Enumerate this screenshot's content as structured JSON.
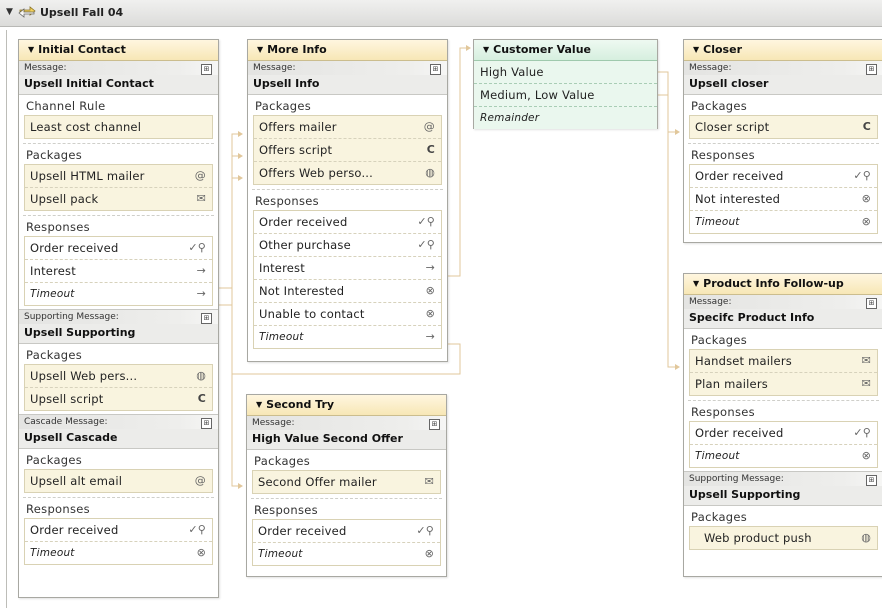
{
  "header": {
    "title": "Upsell Fall 04"
  },
  "icons": {
    "email": "@",
    "script": "C",
    "web": "globe",
    "mail": "envelope",
    "order": "check-search",
    "arrow": "arrow-right",
    "cancel": "circle-x"
  },
  "initial_contact": {
    "title": "Initial Contact",
    "message_label": "Message:",
    "message_name": "Upsell Initial Contact",
    "channel_rule_label": "Channel Rule",
    "channel_rule_value": "Least cost channel",
    "packages_label": "Packages",
    "packages": [
      "Upsell HTML mailer",
      "Upsell pack"
    ],
    "responses_label": "Responses",
    "responses": [
      "Order received",
      "Interest",
      "Timeout"
    ],
    "supporting_label": "Supporting Message:",
    "supporting_name": "Upsell Supporting",
    "supporting_packages_label": "Packages",
    "supporting_packages": [
      "Upsell Web pers...",
      "Upsell script"
    ],
    "cascade_label": "Cascade Message:",
    "cascade_name": "Upsell Cascade",
    "cascade_packages_label": "Packages",
    "cascade_packages": [
      "Upsell alt email"
    ],
    "cascade_responses_label": "Responses",
    "cascade_responses": [
      "Order received",
      "Timeout"
    ]
  },
  "more_info": {
    "title": "More Info",
    "message_label": "Message:",
    "message_name": "Upsell Info",
    "packages_label": "Packages",
    "packages": [
      "Offers mailer",
      "Offers script",
      "Offers Web perso..."
    ],
    "responses_label": "Responses",
    "responses": [
      "Order received",
      "Other purchase",
      "Interest",
      "Not Interested",
      "Unable to contact",
      "Timeout"
    ]
  },
  "customer_value": {
    "title": "Customer Value",
    "rows": [
      "High Value",
      "Medium, Low Value",
      "Remainder"
    ]
  },
  "closer": {
    "title": "Closer",
    "message_label": "Message:",
    "message_name": "Upsell closer",
    "packages_label": "Packages",
    "packages": [
      "Closer script"
    ],
    "responses_label": "Responses",
    "responses": [
      "Order received",
      "Not interested",
      "Timeout"
    ]
  },
  "second_try": {
    "title": "Second Try",
    "message_label": "Message:",
    "message_name": "High Value Second Offer",
    "packages_label": "Packages",
    "packages": [
      "Second Offer mailer"
    ],
    "responses_label": "Responses",
    "responses": [
      "Order received",
      "Timeout"
    ]
  },
  "product_info": {
    "title": "Product Info Follow-up",
    "message_label": "Message:",
    "message_name": "Specifc Product Info",
    "packages_label": "Packages",
    "packages": [
      "Handset mailers",
      "Plan mailers"
    ],
    "responses_label": "Responses",
    "responses": [
      "Order received",
      "Timeout"
    ],
    "supporting_label": "Supporting Message:",
    "supporting_name": "Upsell Supporting",
    "supporting_packages_label": "Packages",
    "supporting_packages": [
      "Web product push"
    ]
  }
}
